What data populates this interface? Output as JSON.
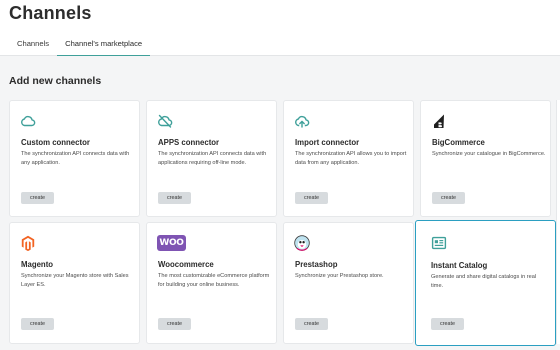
{
  "header": {
    "title": "Channels",
    "tabs": [
      {
        "label": "Channels",
        "active": false
      },
      {
        "label": "Channel's marketplace",
        "active": true
      }
    ]
  },
  "section_title": "Add new channels",
  "colors": {
    "accent": "#3fa09a",
    "selected_border": "#2b9fc1",
    "magento": "#f26322",
    "woo": "#7f54b3",
    "prestashop": "#df0067"
  },
  "cards": [
    {
      "title": "Custom connector",
      "description": "The synchronization API connects data with any application.",
      "button": "create",
      "icon": "cloud-icon"
    },
    {
      "title": "APPS connector",
      "description": "The synchronization API connects data with applications requiring off-line mode.",
      "button": "create",
      "icon": "cloud-off-icon"
    },
    {
      "title": "Import connector",
      "description": "The synchronization API allows you to import data from any application.",
      "button": "create",
      "icon": "cloud-upload-icon"
    },
    {
      "title": "BigCommerce",
      "description": "Synchronize your catalogue in BigCommerce.",
      "button": "create",
      "icon": "bigcommerce-logo"
    },
    {
      "title": "Magento",
      "description": "Synchronize your Magento store with Sales Layer ES.",
      "button": "create",
      "icon": "magento-logo"
    },
    {
      "title": "Woocommerce",
      "description": "The most customizable eCommerce platform for building your online business.",
      "button": "create",
      "icon": "woocommerce-logo",
      "logo_text": "WOO"
    },
    {
      "title": "Prestashop",
      "description": "Synchronize your Prestashop store.",
      "button": "create",
      "icon": "prestashop-logo"
    },
    {
      "title": "Instant Catalog",
      "description": "Generate and share digital catalogs in real time.",
      "button": "create",
      "icon": "catalog-icon",
      "selected": true
    }
  ]
}
